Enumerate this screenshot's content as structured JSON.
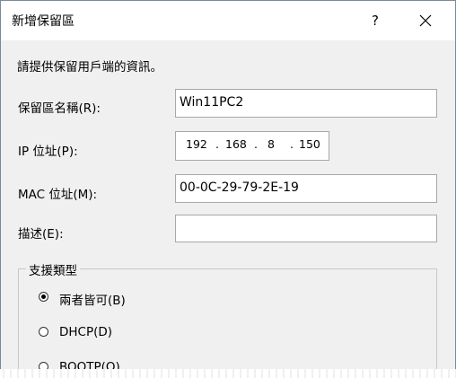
{
  "window": {
    "title": "新增保留區",
    "help_label": "?"
  },
  "form": {
    "instruction": "請提供保留用戶端的資訊。",
    "name_label": "保留區名稱(R):",
    "name_value": "Win11PC2",
    "ip_label": "IP 位址(P):",
    "ip_octets": [
      "192",
      "168",
      "8",
      "150"
    ],
    "ip_separator": ".",
    "mac_label": "MAC 位址(M):",
    "mac_value": "00-0C-29-79-2E-19",
    "desc_label": "描述(E):",
    "desc_value": ""
  },
  "support_type": {
    "title": "支援類型",
    "options": [
      {
        "label": "兩者皆可(B)",
        "checked": true
      },
      {
        "label": "DHCP(D)",
        "checked": false
      },
      {
        "label": "BOOTP(O)",
        "checked": false
      }
    ]
  },
  "colors": {
    "dialog_bg": "#f0f0f0",
    "titlebar_bg": "#ffffff",
    "field_border": "#a8a8a8",
    "window_border": "#7a8a9a"
  }
}
